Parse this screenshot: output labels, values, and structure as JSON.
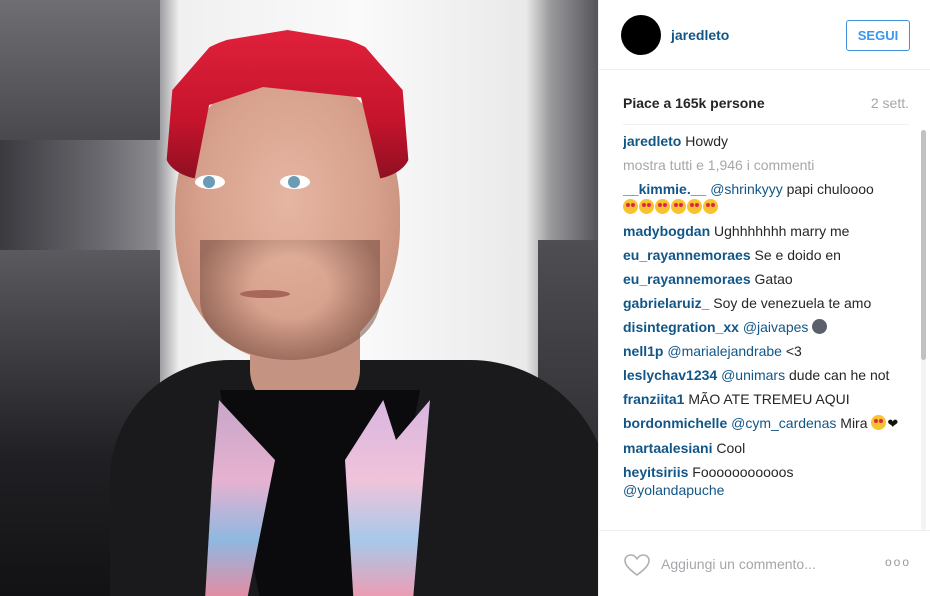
{
  "post": {
    "owner": "jaredleto",
    "follow_label": "SEGUI",
    "likes_text": "Piace a 165k persone",
    "age": "2 sett.",
    "caption": {
      "user": "jaredleto",
      "text": "Howdy"
    },
    "show_all_comments": "mostra tutti e 1,946 i commenti",
    "comment_placeholder": "Aggiungi un commento...",
    "more_label": "ooo"
  },
  "comments": [
    {
      "user": "__kimmie.__",
      "mention": "@shrinkyyy",
      "text": "papi chuloooo",
      "emojis": 6
    },
    {
      "user": "madybogdan",
      "mention": "",
      "text": "Ughhhhhhh marry me"
    },
    {
      "user": "eu_rayannemoraes",
      "mention": "",
      "text": "Se e doido en"
    },
    {
      "user": "eu_rayannemoraes",
      "mention": "",
      "text": "Gatao"
    },
    {
      "user": "gabrielaruiz_",
      "mention": "",
      "text": "Soy de venezuela te amo"
    },
    {
      "user": "disintegration_xx",
      "mention": "@jaivapes",
      "text": "",
      "moon": true
    },
    {
      "user": "nell1p",
      "mention": "@marialejandrabe",
      "text": "<3"
    },
    {
      "user": "leslychav1234",
      "mention": "@unimars",
      "text": "dude can he not"
    },
    {
      "user": "franziita1",
      "mention": "",
      "text": "MÃO ATE TREMEU AQUI"
    },
    {
      "user": "bordonmichelle",
      "mention": "@cym_cardenas",
      "text": "Mira",
      "emojis": 1,
      "heart": true
    },
    {
      "user": "martaalesiani",
      "mention": "",
      "text": "Cool"
    },
    {
      "user": "heyitsiriis",
      "mention": "",
      "text": "Fooooooooooos",
      "mention_after": "@yolandapuche"
    }
  ],
  "icons": {
    "like": "heart-outline-icon",
    "more": "more-options-icon"
  },
  "colors": {
    "link": "#125688",
    "follow": "#3897f0",
    "muted": "#a5a7aa"
  }
}
